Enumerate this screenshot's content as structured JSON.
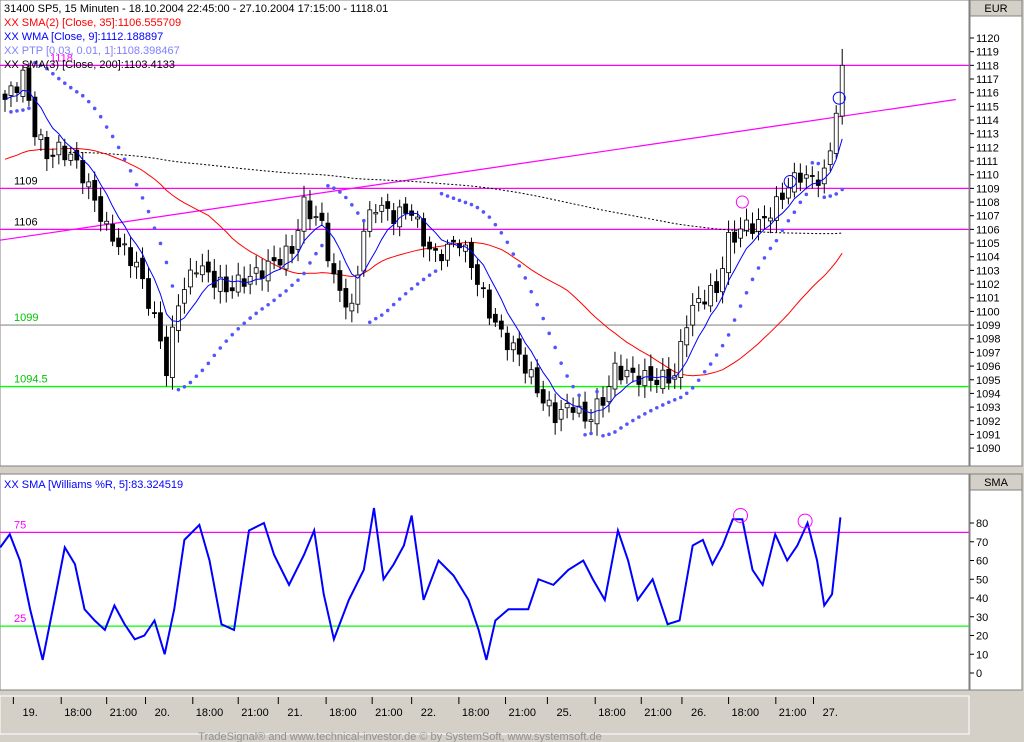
{
  "header": {
    "title": "31400  SP5, 15 Minuten - 18.10.2004 22:45:00 - 27.10.2004 17:15:00 - 1118.01",
    "currency": "EUR",
    "lower_unit": "SMA"
  },
  "legend": [
    {
      "text": "XX SMA(2) [Close, 35]:1106.555709",
      "color": "#ff0000"
    },
    {
      "text": "XX WMA [Close, 9]:1112.188897",
      "color": "#0000ff"
    },
    {
      "text": "XX PTP [0.03, 0.01, 1]:1108.398467",
      "color": "#7f7fff"
    },
    {
      "text": "XX SMA(3) [Close, 200]:1103.4133",
      "color": "#000000"
    }
  ],
  "lower_legend": "XX SMA [Williams %R, 5]:83.324519",
  "footer": "TradeSignal® and www.technical-investor.de © by SystemSoft, www.systemsoft.de",
  "chart_data": [
    {
      "type": "candlestick",
      "title": "SP5, 15 Minuten",
      "ylim": [
        1089,
        1121
      ],
      "yticks": [
        1090,
        1091,
        1092,
        1093,
        1094,
        1095,
        1096,
        1097,
        1098,
        1099,
        1100,
        1101,
        1102,
        1103,
        1104,
        1105,
        1106,
        1107,
        1108,
        1109,
        1110,
        1111,
        1112,
        1113,
        1114,
        1115,
        1116,
        1117,
        1118,
        1119,
        1120
      ],
      "bars": 141,
      "close_keypoints": [
        [
          0,
          1115.5
        ],
        [
          2,
          1116.6
        ],
        [
          3,
          1117.3
        ],
        [
          5,
          1113.3
        ],
        [
          7,
          1111.4
        ],
        [
          9,
          1111.8
        ],
        [
          11,
          1111.4
        ],
        [
          13,
          1110
        ],
        [
          15,
          1108.1
        ],
        [
          17,
          1106
        ],
        [
          19,
          1104.9
        ],
        [
          22,
          1103.4
        ],
        [
          24,
          1100.8
        ],
        [
          26,
          1097.9
        ],
        [
          27,
          1095.7
        ],
        [
          29,
          1100.8
        ],
        [
          32,
          1103.4
        ],
        [
          37,
          1101.6
        ],
        [
          43,
          1103
        ],
        [
          48,
          1104.5
        ],
        [
          50,
          1107.8
        ],
        [
          53,
          1106.3
        ],
        [
          55,
          1102.3
        ],
        [
          58,
          1100
        ],
        [
          60,
          1106
        ],
        [
          62,
          1107.8
        ],
        [
          65,
          1107
        ],
        [
          68,
          1107.4
        ],
        [
          70,
          1105.2
        ],
        [
          72,
          1104
        ],
        [
          76,
          1105.2
        ],
        [
          78,
          1103.4
        ],
        [
          81,
          1100
        ],
        [
          83,
          1098.3
        ],
        [
          86,
          1096.8
        ],
        [
          90,
          1093.5
        ],
        [
          92,
          1092.4
        ],
        [
          95,
          1093.2
        ],
        [
          97,
          1092
        ],
        [
          100,
          1093.5
        ],
        [
          102,
          1095.7
        ],
        [
          105,
          1095.3
        ],
        [
          109,
          1095
        ],
        [
          112,
          1095.3
        ],
        [
          114,
          1099.4
        ],
        [
          116,
          1100.8
        ],
        [
          119,
          1101.6
        ],
        [
          121,
          1105.2
        ],
        [
          124,
          1106.3
        ],
        [
          126,
          1106.3
        ],
        [
          129,
          1107.8
        ],
        [
          131,
          1109.2
        ],
        [
          133,
          1110
        ],
        [
          135,
          1109.6
        ],
        [
          137,
          1110
        ],
        [
          138,
          1111.8
        ],
        [
          140,
          1118
        ]
      ],
      "hlines": [
        {
          "value": 1118,
          "label": "1118",
          "color": "#ff00ff"
        },
        {
          "value": 1109,
          "label": "1109",
          "color": "#ff00ff"
        },
        {
          "value": 1106,
          "label": "1106",
          "color": "#ff00ff"
        },
        {
          "value": 1099,
          "label": "1099",
          "color": "#a0a0a0",
          "label_color": "#00c000"
        },
        {
          "value": 1094.5,
          "label": "1094.5",
          "color": "#00ff00",
          "label_color": "#00c000"
        }
      ],
      "trendline": {
        "from": [
          -1,
          1105.2
        ],
        "to": [
          159,
          1115.5
        ],
        "color": "#ff00ff"
      },
      "markers": [
        {
          "bar": 123.3,
          "value": 1108,
          "color": "#ff00ff"
        },
        {
          "bar": 131.3,
          "value": 1109.5,
          "color": "#0000ff"
        },
        {
          "bar": 139.5,
          "value": 1115.6,
          "color": "#0000ff"
        }
      ]
    },
    {
      "type": "line",
      "title": "SMA [Williams %R, 5]",
      "ylim": [
        -15,
        95
      ],
      "yticks": [
        0,
        10,
        20,
        30,
        40,
        50,
        60,
        70,
        80
      ],
      "points": [
        [
          -0.8,
          67
        ],
        [
          0.8,
          74
        ],
        [
          2.5,
          60
        ],
        [
          4.2,
          34
        ],
        [
          6.3,
          7
        ],
        [
          8.3,
          39
        ],
        [
          10,
          67
        ],
        [
          11.7,
          58
        ],
        [
          13.3,
          34
        ],
        [
          15,
          28
        ],
        [
          16.7,
          23
        ],
        [
          18.3,
          36
        ],
        [
          20,
          26
        ],
        [
          21.7,
          18
        ],
        [
          23.3,
          20
        ],
        [
          25,
          28
        ],
        [
          26.7,
          10
        ],
        [
          28.3,
          34
        ],
        [
          30,
          71
        ],
        [
          32.5,
          79
        ],
        [
          34.2,
          60
        ],
        [
          36.2,
          26
        ],
        [
          38.3,
          23
        ],
        [
          40.8,
          76
        ],
        [
          43.3,
          80
        ],
        [
          45,
          63
        ],
        [
          47.5,
          47
        ],
        [
          50,
          63
        ],
        [
          51.7,
          76
        ],
        [
          53.3,
          42
        ],
        [
          55,
          18
        ],
        [
          57.5,
          39
        ],
        [
          60,
          55
        ],
        [
          61.7,
          88
        ],
        [
          63.3,
          50
        ],
        [
          65,
          58
        ],
        [
          66.7,
          68
        ],
        [
          68,
          84
        ],
        [
          70,
          39
        ],
        [
          72.5,
          60
        ],
        [
          75,
          52
        ],
        [
          77.5,
          39
        ],
        [
          79.2,
          23
        ],
        [
          80.5,
          7
        ],
        [
          82,
          28
        ],
        [
          84.2,
          34
        ],
        [
          87.5,
          34
        ],
        [
          89.2,
          50
        ],
        [
          91.7,
          47
        ],
        [
          94.2,
          55
        ],
        [
          96.7,
          60
        ],
        [
          98.3,
          50
        ],
        [
          100.3,
          39
        ],
        [
          102.5,
          76
        ],
        [
          104.2,
          60
        ],
        [
          105.8,
          39
        ],
        [
          108.3,
          50
        ],
        [
          110.8,
          26
        ],
        [
          112.8,
          28
        ],
        [
          115,
          68
        ],
        [
          116.7,
          71
        ],
        [
          118.3,
          58
        ],
        [
          120,
          68
        ],
        [
          121.7,
          82
        ],
        [
          123.3,
          82
        ],
        [
          125,
          55
        ],
        [
          126.7,
          47
        ],
        [
          128.8,
          74
        ],
        [
          130.8,
          60
        ],
        [
          132.5,
          68
        ],
        [
          134.2,
          80
        ],
        [
          135.8,
          60
        ],
        [
          137,
          36
        ],
        [
          138.3,
          42
        ],
        [
          139.7,
          83
        ]
      ],
      "hlines": [
        {
          "value": 75,
          "label": "75",
          "color": "#ff00ff"
        },
        {
          "value": 25,
          "label": "25",
          "color": "#00ff00"
        }
      ],
      "markers": [
        {
          "bar": 123,
          "value": 84
        },
        {
          "bar": 133.8,
          "value": 81
        }
      ]
    }
  ],
  "xaxis": {
    "ticks": [
      {
        "bar": 4.2,
        "label": "19."
      },
      {
        "bar": 12.2,
        "label": "18:00"
      },
      {
        "bar": 19.8,
        "label": "21:00"
      },
      {
        "bar": 26.3,
        "label": "20."
      },
      {
        "bar": 34.2,
        "label": "18:00"
      },
      {
        "bar": 41.8,
        "label": "21:00"
      },
      {
        "bar": 48.5,
        "label": "21."
      },
      {
        "bar": 56.5,
        "label": "18:00"
      },
      {
        "bar": 64.2,
        "label": "21:00"
      },
      {
        "bar": 70.8,
        "label": "22."
      },
      {
        "bar": 78.7,
        "label": "18:00"
      },
      {
        "bar": 86.5,
        "label": "21:00"
      },
      {
        "bar": 93.5,
        "label": "25."
      },
      {
        "bar": 101.5,
        "label": "18:00"
      },
      {
        "bar": 109.2,
        "label": "21:00"
      },
      {
        "bar": 116,
        "label": "26."
      },
      {
        "bar": 123.8,
        "label": "18:00"
      },
      {
        "bar": 131.7,
        "label": "21:00"
      },
      {
        "bar": 138,
        "label": "27."
      }
    ]
  }
}
